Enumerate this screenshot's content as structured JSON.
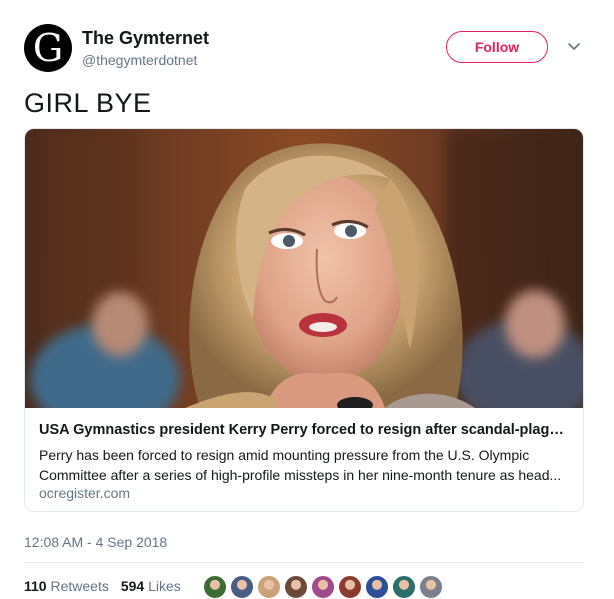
{
  "tweet": {
    "author": {
      "avatar_letter": "G",
      "display_name": "The Gymternet",
      "handle": "@thegymterdotnet"
    },
    "follow_label": "Follow",
    "text": "GIRL BYE",
    "card": {
      "title": "USA Gymnastics president Kerry Perry forced to resign after scandal-plague...",
      "description": "Perry has been forced to resign amid mounting pressure from the U.S. Olympic Committee after a series of high-profile missteps in her nine-month tenure as head...",
      "domain": "ocregister.com"
    },
    "timestamp": "12:08 AM - 4 Sep 2018",
    "stats": {
      "retweets_count": "110",
      "retweets_label": "Retweets",
      "likes_count": "594",
      "likes_label": "Likes"
    }
  },
  "colors": {
    "follow_accent": "#e0245e",
    "secondary_text": "#657786",
    "primary_text": "#14171a"
  },
  "icons": {
    "menu": "chevron-down-icon"
  },
  "liker_avatars": [
    {
      "color": "#3d6b35"
    },
    {
      "color": "#4a5d82"
    },
    {
      "color": "#c9a27a"
    },
    {
      "color": "#6b4a3a"
    },
    {
      "color": "#a04a8c"
    },
    {
      "color": "#8a3a2e"
    },
    {
      "color": "#2f4e9a"
    },
    {
      "color": "#2e6e6a"
    },
    {
      "color": "#7d7f8a"
    }
  ]
}
